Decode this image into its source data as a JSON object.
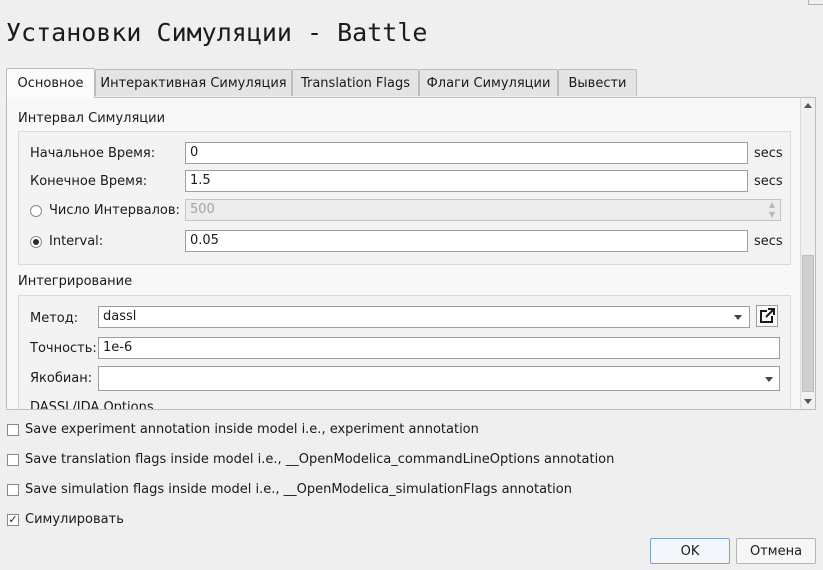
{
  "dialog": {
    "title": "Установки Симуляции - Battle"
  },
  "tabs": [
    {
      "label": "Основное",
      "active": true
    },
    {
      "label": "Интерактивная Симуляция",
      "active": false
    },
    {
      "label": "Translation Flags",
      "active": false
    },
    {
      "label": "Флаги Симуляции",
      "active": false
    },
    {
      "label": "Вывести",
      "active": false
    }
  ],
  "interval": {
    "group_title": "Интервал Симуляции",
    "start_time": {
      "label": "Начальное Время:",
      "value": "0",
      "unit": "secs"
    },
    "stop_time": {
      "label": "Конечное Время:",
      "value": "1.5",
      "unit": "secs"
    },
    "num_intervals": {
      "label": "Число Интервалов:",
      "value": "500",
      "selected": false,
      "enabled": false
    },
    "interval": {
      "label": "Interval:",
      "value": "0.05",
      "unit": "secs",
      "selected": true
    }
  },
  "integration": {
    "group_title": "Интегрирование",
    "method": {
      "label": "Метод:",
      "value": "dassl"
    },
    "tolerance": {
      "label": "Точность:",
      "value": "1e-6"
    },
    "jacobian": {
      "label": "Якобиан:",
      "value": ""
    },
    "solver_options_title": "DASSL/IDA Options"
  },
  "checkboxes": {
    "save_experiment": {
      "label": "Save experiment annotation inside model i.e., experiment annotation",
      "checked": false
    },
    "save_translation": {
      "label": "Save translation flags inside model i.e., __OpenModelica_commandLineOptions annotation",
      "checked": false
    },
    "save_simulation": {
      "label": "Save simulation flags inside model i.e., __OpenModelica_simulationFlags annotation",
      "checked": false
    },
    "simulate": {
      "label": "Симулировать",
      "checked": true,
      "mark": "✓"
    }
  },
  "buttons": {
    "ok": "OK",
    "cancel": "Отмена"
  },
  "colors": {
    "background": "#efefef",
    "panel": "#f8f8f8",
    "default_button_border": "#7aa1cf"
  }
}
